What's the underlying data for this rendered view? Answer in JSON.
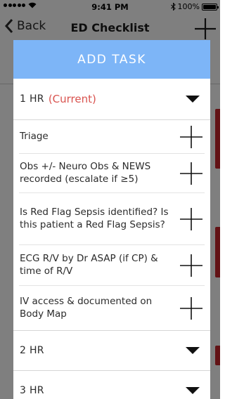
{
  "status_bar": {
    "time": "9:41 PM",
    "battery": "100%",
    "battery_level": 1.0
  },
  "nav": {
    "back_label": "Back",
    "title": "ED Checklist"
  },
  "modal": {
    "title": "ADD TASK",
    "active_hour": {
      "label": "1 HR",
      "status": "(Current)"
    },
    "tasks": [
      {
        "text": "Triage"
      },
      {
        "text": "Obs +/- Neuro Obs & NEWS recorded (escalate if ≥5)"
      },
      {
        "text": "Is Red Flag Sepsis identified? Is this patient a Red Flag Sepsis?"
      },
      {
        "text": "ECG R/V by Dr ASAP (if CP) & time of R/V"
      },
      {
        "text": "IV access & documented on Body Map"
      }
    ],
    "other_hours": [
      {
        "label": "2 HR"
      },
      {
        "label": "3 HR"
      }
    ]
  },
  "colors": {
    "header_bg": "#7db5f7",
    "current_text": "#d9534f",
    "accent_red": "#c5242a",
    "overlay": "rgba(0,0,0,0.5)"
  },
  "icons": {
    "back": "chevron-left-icon",
    "add": "plus-icon",
    "expand": "caret-down-icon"
  }
}
